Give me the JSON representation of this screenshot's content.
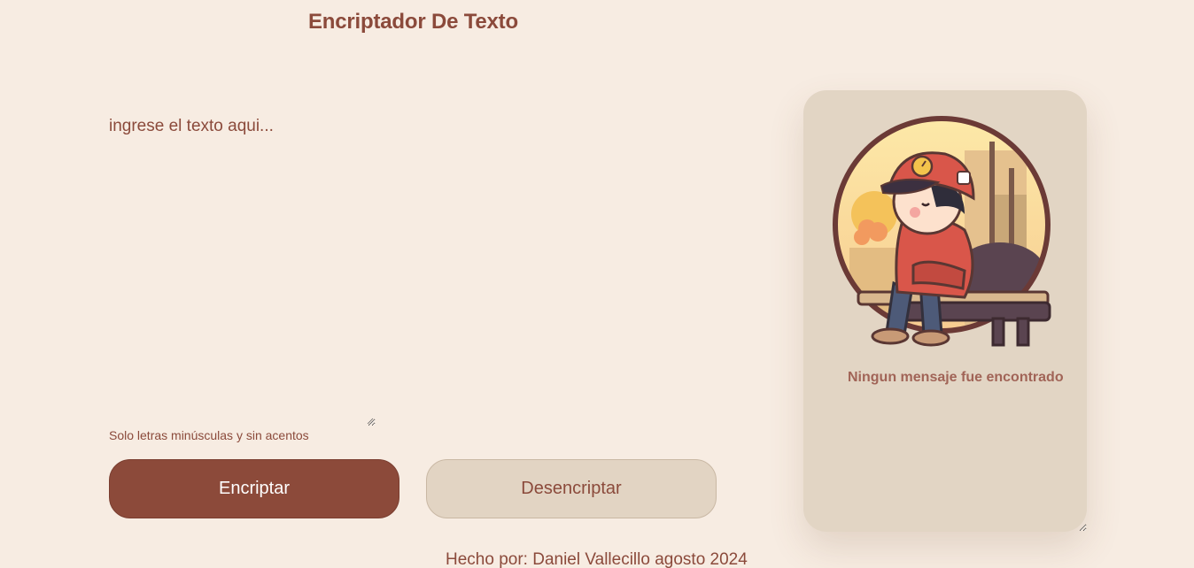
{
  "header": {
    "title": "Encriptador De Texto"
  },
  "input": {
    "placeholder": "ingrese el texto aqui...",
    "value": ""
  },
  "hint": "Solo letras minúsculas y sin acentos",
  "buttons": {
    "encrypt": "Encriptar",
    "decrypt": "Desencriptar"
  },
  "output": {
    "empty_message": "Ningun mensaje fue encontrado",
    "illustration": "boy-sitting-on-bench-illustration"
  },
  "footer": "Hecho por: Daniel Vallecillo agosto 2024",
  "colors": {
    "background": "#f7ece2",
    "primary": "#8c4a3a",
    "secondary": "#e2d4c3",
    "card": "#e2d5c4",
    "text": "#8b4a3b"
  }
}
